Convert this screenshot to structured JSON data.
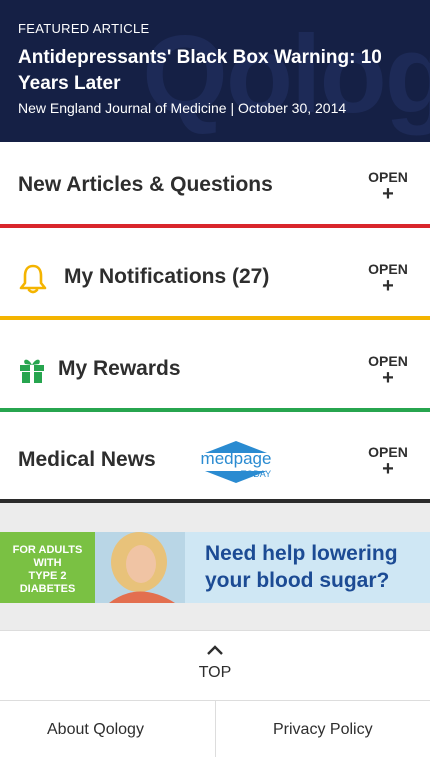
{
  "featured": {
    "kicker": "FEATURED ARTICLE",
    "title": "Antidepressants' Black Box Warning: 10 Years Later",
    "meta": "New England Journal of Medicine | October 30, 2014"
  },
  "sections": [
    {
      "label": "New Articles & Questions",
      "open_label": "OPEN",
      "open_plus": "+",
      "accent": "#d9262c"
    },
    {
      "label": "My Notifications (27)",
      "open_label": "OPEN",
      "open_plus": "+",
      "icon": "bell-icon",
      "accent": "#f4b400"
    },
    {
      "label": "My Rewards",
      "open_label": "OPEN",
      "open_plus": "+",
      "icon": "gift-icon",
      "accent": "#27a54f"
    },
    {
      "label": "Medical News",
      "open_label": "OPEN",
      "open_plus": "+",
      "accent": "#2b2b2b",
      "logo": {
        "top": "medpage",
        "bottom": "TODAY"
      }
    }
  ],
  "ad": {
    "badge_lines": [
      "FOR ADULTS",
      "WITH",
      "TYPE 2 DIABETES"
    ],
    "headline": "Need help lowering your blood sugar?"
  },
  "top_link": {
    "label": "TOP"
  },
  "footer": {
    "about": "About Qology",
    "privacy": "Privacy Policy"
  },
  "colors": {
    "header_bg": "#152045",
    "brand_blue": "#2a8bd1",
    "ad_green": "#7ac143"
  }
}
